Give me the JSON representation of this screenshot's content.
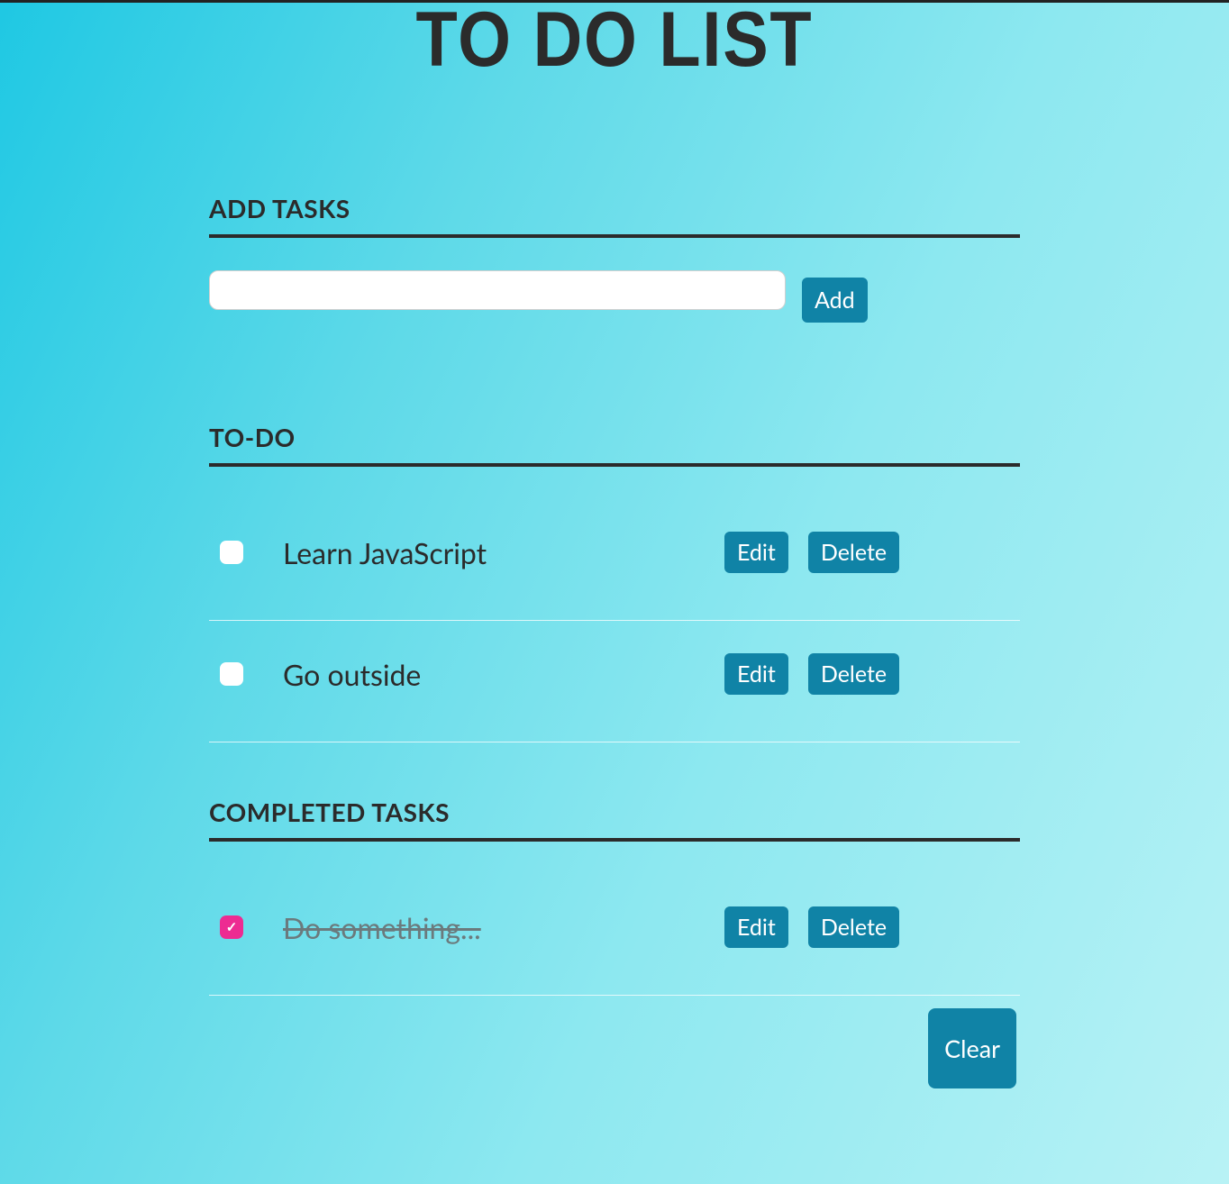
{
  "title": "TO DO LIST",
  "headings": {
    "add": "ADD TASKS",
    "todo": "TO-DO",
    "completed": "COMPLETED TASKS"
  },
  "input": {
    "value": "",
    "placeholder": ""
  },
  "buttons": {
    "add": "Add",
    "edit": "Edit",
    "delete": "Delete",
    "clear": "Clear"
  },
  "todo_tasks": [
    {
      "label": "Learn JavaScript",
      "checked": false
    },
    {
      "label": "Go outside",
      "checked": false
    }
  ],
  "completed_tasks": [
    {
      "label": "Do something...",
      "checked": true
    }
  ],
  "colors": {
    "accent": "#1083a6",
    "checkbox_checked": "#ed2b92",
    "text": "#2b2b2b"
  }
}
